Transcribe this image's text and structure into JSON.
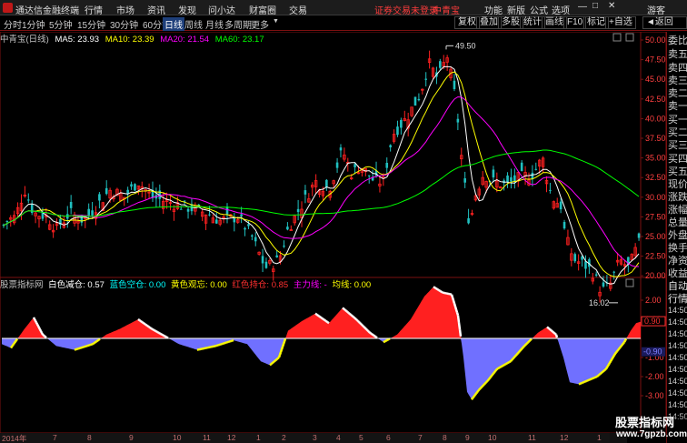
{
  "app": {
    "name": "通达信金融终端",
    "menu": [
      "行情",
      "市场",
      "资讯",
      "发现",
      "问小达",
      "财富圈",
      "交易"
    ],
    "right_menu": [
      "功能",
      "新版",
      "公式",
      "选项"
    ],
    "user": "游客",
    "security_notice": "证券交易未登录",
    "stock_name": "中青宝"
  },
  "toolbar": {
    "periods": [
      "分时",
      "1分钟",
      "5分钟",
      "15分钟",
      "30分钟",
      "60分钟",
      "日线",
      "周线",
      "月线",
      "多周期",
      "更多"
    ],
    "selected": "日线",
    "tools": [
      "复权",
      "叠加",
      "多股",
      "统计",
      "画线",
      "F10",
      "标记",
      "+自选"
    ],
    "back": "◄返回"
  },
  "ma_line": {
    "name": "中青宝(日线)",
    "items": [
      {
        "label": "MA5: 23.93",
        "color": "#ffffff"
      },
      {
        "label": "MA10: 23.39",
        "color": "#ffff00"
      },
      {
        "label": "MA20: 21.54",
        "color": "#ff00ff"
      },
      {
        "label": "MA60: 23.17",
        "color": "#00ff00"
      }
    ]
  },
  "indicator_line": {
    "name": "股票指标网",
    "items": [
      {
        "label": "白色减仓: 0.57",
        "color": "#ffffff"
      },
      {
        "label": "蓝色空仓: 0.00",
        "color": "#00ffff"
      },
      {
        "label": "黄色观忘: 0.00",
        "color": "#ffff00"
      },
      {
        "label": "红色持仓: 0.85",
        "color": "#ff3030"
      },
      {
        "label": "主力线: -",
        "color": "#ff00ff"
      },
      {
        "label": "均线: 0.00",
        "color": "#ffff00"
      }
    ]
  },
  "price_axis": [
    "50.00",
    "47.50",
    "45.00",
    "42.50",
    "40.00",
    "37.50",
    "35.00",
    "32.50",
    "30.00",
    "27.50",
    "25.00",
    "22.50",
    "20.00"
  ],
  "ind_axis": [
    "2.00",
    "1.00",
    "-1.00",
    "-2.00",
    "-3.00"
  ],
  "ind_axis_current": "0.90",
  "ind_axis_neg": "-0.90",
  "annotations": {
    "high": "49.50",
    "low": "16.02"
  },
  "right_panel": [
    "委比",
    "卖五",
    "卖四",
    "卖三",
    "卖二",
    "卖一",
    "买一",
    "买二",
    "买三",
    "买四",
    "买五",
    "现价",
    "涨跌",
    "涨幅",
    "总量",
    "外盘",
    "换手",
    "净资",
    "收益",
    "自动",
    "行情",
    "14:50",
    "14:50",
    "14:50",
    "14:50",
    "14:50",
    "14:50",
    "14:50",
    "14:50",
    "14:50",
    "14:50"
  ],
  "date_tabs": [
    "2014年",
    "7",
    "8",
    "9",
    "10",
    "11",
    "12",
    "1",
    "2",
    "3",
    "4",
    "5",
    "6",
    "7",
    "8",
    "9",
    "10",
    "11",
    "12",
    "1"
  ],
  "watermark": {
    "title": "股票指标网",
    "url": "www.7gpzb.com"
  },
  "colors": {
    "up": "#ff2020",
    "down": "#7070ff",
    "ma5": "#ffffff",
    "ma10": "#ffff00",
    "ma20": "#ff00ff",
    "ma60": "#00ff00",
    "grid": "#7a1010",
    "axis_text": "#ff4040"
  }
}
